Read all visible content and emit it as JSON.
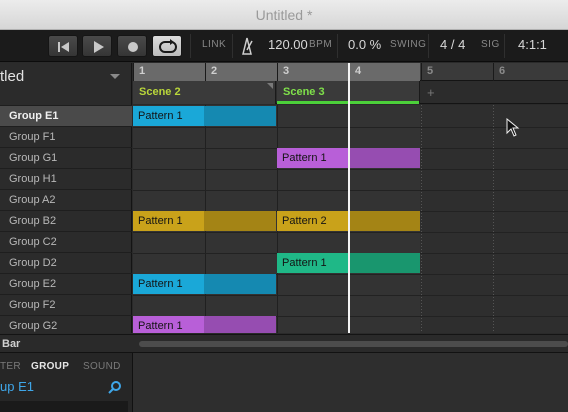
{
  "window": {
    "title": "Untitled *"
  },
  "transport": {
    "link_label": "LINK",
    "tempo": "120.00",
    "tempo_unit": "BPM",
    "swing": "0.0 %",
    "swing_label": "SWING",
    "signature": "4 / 4",
    "signature_label": "SIG",
    "position": "4:1:1"
  },
  "project": {
    "name": "tled"
  },
  "groups": [
    "Group E1",
    "Group F1",
    "Group G1",
    "Group H1",
    "Group A2",
    "Group B2",
    "Group C2",
    "Group D2",
    "Group E2",
    "Group F2",
    "Group G2"
  ],
  "selected_group_index": 0,
  "ruler": {
    "bars": [
      "1",
      "2",
      "3",
      "4",
      "5",
      "6"
    ]
  },
  "scenes": [
    {
      "label": "Scene 2"
    },
    {
      "label": "Scene 3"
    }
  ],
  "scene_add_label": "+",
  "clips": [
    {
      "label": "Pattern 1",
      "color": "#1aa8d8"
    },
    {
      "label": "Pattern 1",
      "color": "#b85fd8"
    },
    {
      "label": "Pattern 1",
      "color": "#c9a21a"
    },
    {
      "label": "Pattern 2",
      "color": "#c9a21a"
    },
    {
      "label": "Pattern 1",
      "color": "#1fb887"
    },
    {
      "label": "Pattern 1",
      "color": "#1aa8d8"
    },
    {
      "label": "Pattern 1",
      "color": "#b85fd8"
    }
  ],
  "footer": {
    "bar_label": "Bar"
  },
  "browser": {
    "tabs": [
      "TER",
      "GROUP",
      "SOUND"
    ],
    "active_tab": "GROUP",
    "selected": "up E1"
  },
  "icons": {
    "rewind": "rewind-icon",
    "play": "play-icon",
    "record": "record-icon",
    "loop": "loop-icon",
    "metronome": "metronome-icon",
    "search": "search-icon",
    "cursor": "mouse-pointer-icon"
  }
}
